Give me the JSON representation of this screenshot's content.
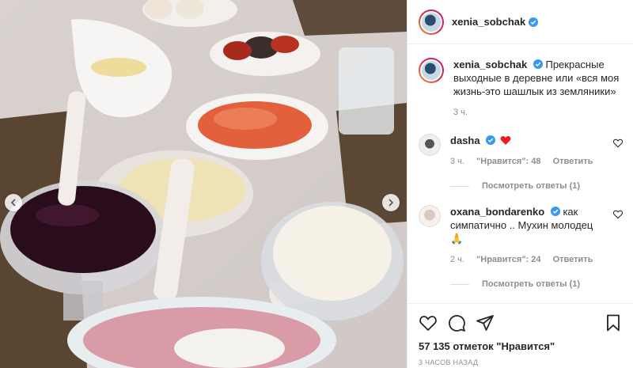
{
  "post": {
    "username": "xenia_sobchak",
    "caption_user": "xenia_sobchak",
    "caption_text": "Прекрасные выходные в деревне или «вся моя жизнь-это шашлык из земляники»",
    "caption_time": "3 ч.",
    "likes": "57 135 отметок \"Нравится\"",
    "posted": "3 ЧАСОВ НАЗАД"
  },
  "comments": [
    {
      "user": "dasha",
      "text": "",
      "emoji": "heart",
      "time": "3 ч.",
      "likes": "\"Нравится\": 48",
      "reply": "Ответить",
      "view_replies": "Посмотреть ответы (1)"
    },
    {
      "user": "oxana_bondarenko",
      "text": "как симпатично .. Мухин молодец",
      "emoji": "",
      "time": "2 ч.",
      "likes": "\"Нравится\": 24",
      "reply": "Ответить",
      "view_replies": "Посмотреть ответы (1)"
    }
  ],
  "colors": {
    "accent": "#0095f6",
    "heart": "#ed4956",
    "text": "#262626",
    "muted": "#8e8e8e"
  },
  "icons": [
    "like-icon",
    "comment-icon",
    "share-icon",
    "save-icon",
    "verified-icon",
    "chevron-left-icon",
    "chevron-right-icon"
  ]
}
